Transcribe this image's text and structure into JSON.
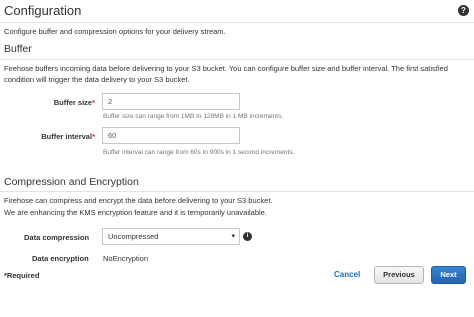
{
  "header": {
    "title": "Configuration",
    "help_icon": "?",
    "subtitle": "Configure buffer and compression options for your delivery stream."
  },
  "buffer": {
    "heading": "Buffer",
    "description_line1": "Firehose buffers incoming data before delivering to your S3 bucket. You can configure buffer size and buffer interval. The first satisfied",
    "description_line2": "condition will trigger the data delivery to your S3 bucket.",
    "size": {
      "label": "Buffer size",
      "required_mark": "*",
      "value": "2",
      "hint": "Buffer size can range from 1MB to 128MB in 1 MB increments."
    },
    "interval": {
      "label": "Buffer interval",
      "required_mark": "*",
      "value": "60",
      "hint": "Buffer interval can range from 60s to 900s in 1 second increments."
    }
  },
  "compression": {
    "heading": "Compression and Encryption",
    "description_line1": "Firehose can compress and encrypt the data before delivering to your S3 bucket.",
    "description_line2": "We are enhancing the KMS encryption feature and it is temporarily unavailable.",
    "data_compression": {
      "label": "Data compression",
      "selected": "Uncompressed",
      "caret": "▾",
      "info_icon": "i"
    },
    "data_encryption": {
      "label": "Data encryption",
      "value": "NoEncryption"
    }
  },
  "footer": {
    "required_note": "*Required",
    "cancel_label": "Cancel",
    "previous_label": "Previous",
    "next_label": "Next"
  },
  "colors": {
    "accent": "#2264b0",
    "link": "#1a6dc0",
    "required": "#cc3333"
  }
}
